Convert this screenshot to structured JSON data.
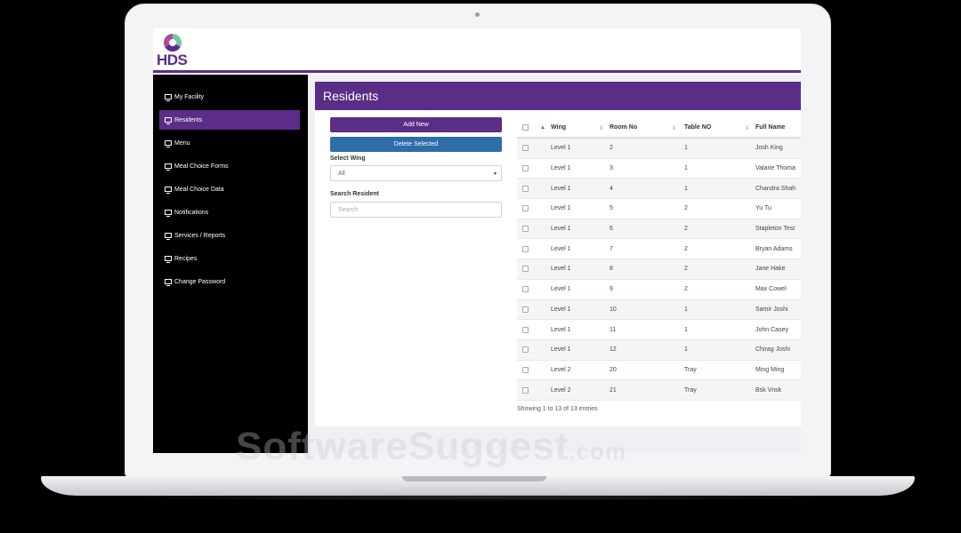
{
  "brand": {
    "logo_text": "HDS"
  },
  "sidebar": {
    "items": [
      {
        "label": "My Facility",
        "icon": "monitor-icon",
        "active": false
      },
      {
        "label": "Residents",
        "icon": "monitor-icon",
        "active": true
      },
      {
        "label": "Menu",
        "icon": "monitor-icon",
        "active": false
      },
      {
        "label": "Meal Choice Forms",
        "icon": "monitor-icon",
        "active": false
      },
      {
        "label": "Meal Choice Data",
        "icon": "monitor-icon",
        "active": false
      },
      {
        "label": "Notifications",
        "icon": "monitor-icon",
        "active": false
      },
      {
        "label": "Services / Reports",
        "icon": "monitor-icon",
        "active": false
      },
      {
        "label": "Recipes",
        "icon": "monitor-icon",
        "active": false
      },
      {
        "label": "Change Password",
        "icon": "monitor-icon",
        "active": false
      }
    ]
  },
  "page": {
    "title": "Residents"
  },
  "actions": {
    "add_new": "Add New",
    "delete_selected": "Delete Selected"
  },
  "filters": {
    "wing_label": "Select Wing",
    "wing_value": "All",
    "search_label": "Search Resident",
    "search_placeholder": "Search"
  },
  "table": {
    "columns": [
      "Wing",
      "Room No",
      "Table NO",
      "Full Name"
    ],
    "rows": [
      [
        "Level 1",
        "2",
        "1",
        "Josh King"
      ],
      [
        "Level 1",
        "3",
        "1",
        "Valarie Thoma"
      ],
      [
        "Level 1",
        "4",
        "1",
        "Chandra Shah"
      ],
      [
        "Level 1",
        "5",
        "2",
        "Yu Tu"
      ],
      [
        "Level 1",
        "6",
        "2",
        "Stapleton Test"
      ],
      [
        "Level 1",
        "7",
        "2",
        "Bryan Adams"
      ],
      [
        "Level 1",
        "8",
        "2",
        "Jane Hake"
      ],
      [
        "Level 1",
        "9",
        "2",
        "Max Cowel"
      ],
      [
        "Level 1",
        "10",
        "1",
        "Samir Joshi"
      ],
      [
        "Level 1",
        "11",
        "1",
        "John Casey"
      ],
      [
        "Level 1",
        "12",
        "1",
        "Chirag Joshi"
      ],
      [
        "Level 2",
        "20",
        "Tray",
        "Ming Ming"
      ],
      [
        "Level 2",
        "21",
        "Tray",
        "Bsk Vnsk"
      ]
    ],
    "info": "Showing 1 to 13 of 13 entries"
  },
  "watermark": {
    "text": "SoftwareSuggest",
    "suffix": ".com"
  },
  "colors": {
    "brand_purple": "#5b2d86",
    "delete_blue": "#2d6da8",
    "sidebar_bg": "#000000"
  }
}
